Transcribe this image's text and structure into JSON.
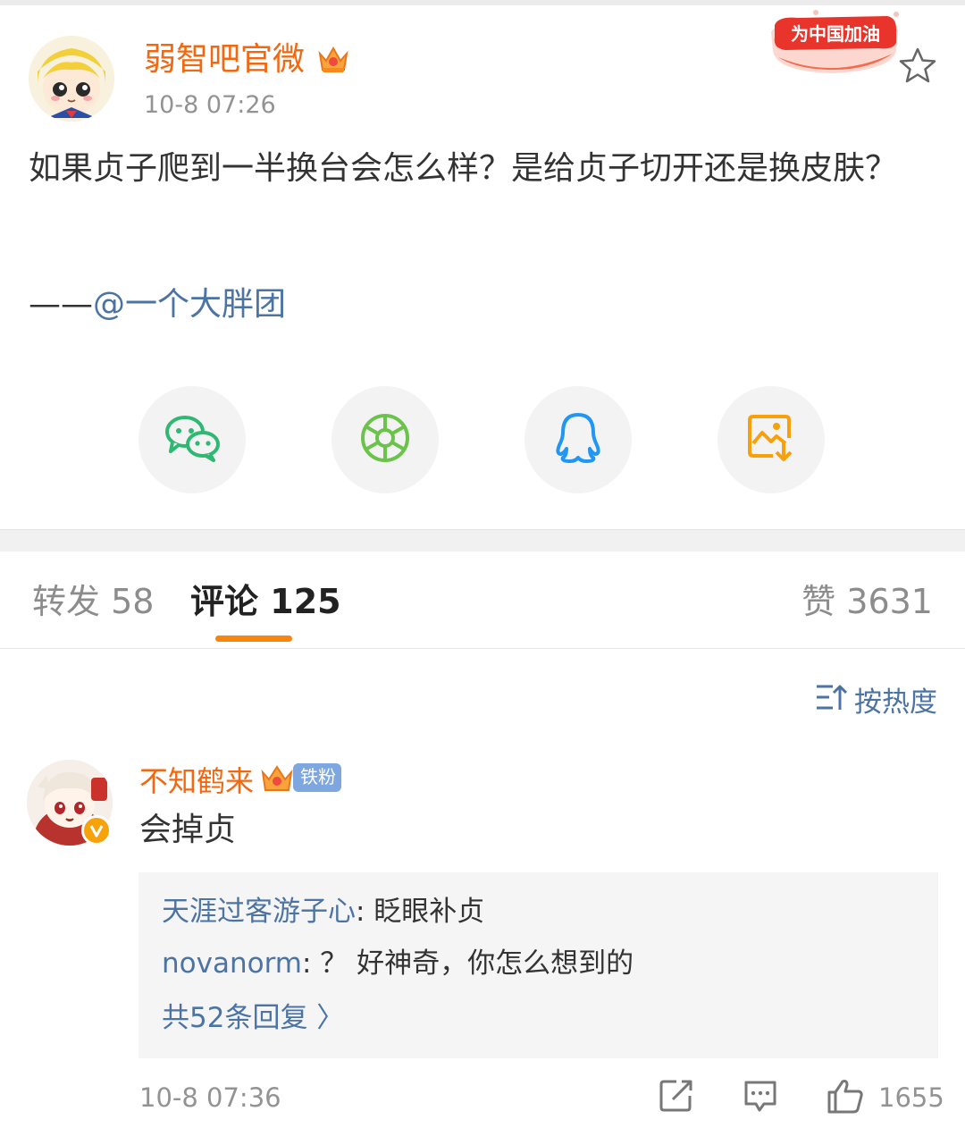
{
  "post": {
    "author": "弱智吧官微",
    "time": "10-8 07:26",
    "body": "如果贞子爬到一半换台会怎么样？是给贞子切开还是换皮肤？",
    "credit_prefix": "——",
    "credit_mention": "@一个大胖团",
    "promo_badge_text": "为中国加油"
  },
  "share": {
    "items": [
      "wechat-icon",
      "moments-icon",
      "qq-icon",
      "save-image-icon"
    ]
  },
  "tabs": {
    "repost_label": "转发",
    "repost_count": "58",
    "comment_label": "评论",
    "comment_count": "125",
    "like_label": "赞",
    "like_count": "3631"
  },
  "sort": {
    "label": "按热度"
  },
  "comment": {
    "user": "不知鹤来",
    "fan_badge": "铁粉",
    "text": "会掉贞",
    "replies": [
      {
        "user": "天涯过客游子心",
        "sep": ": ",
        "text": "眨眼补贞"
      },
      {
        "user": "novanorm",
        "sep": ": ",
        "text": "？ 好神奇，你怎么想到的"
      }
    ],
    "more_replies": "共52条回复 〉",
    "time": "10-8 07:36",
    "likes": "1655"
  },
  "colors": {
    "accent_orange": "#f7850f",
    "name_orange": "#f2670f",
    "link_blue": "#4b74a5",
    "muted_gray": "#939393"
  }
}
